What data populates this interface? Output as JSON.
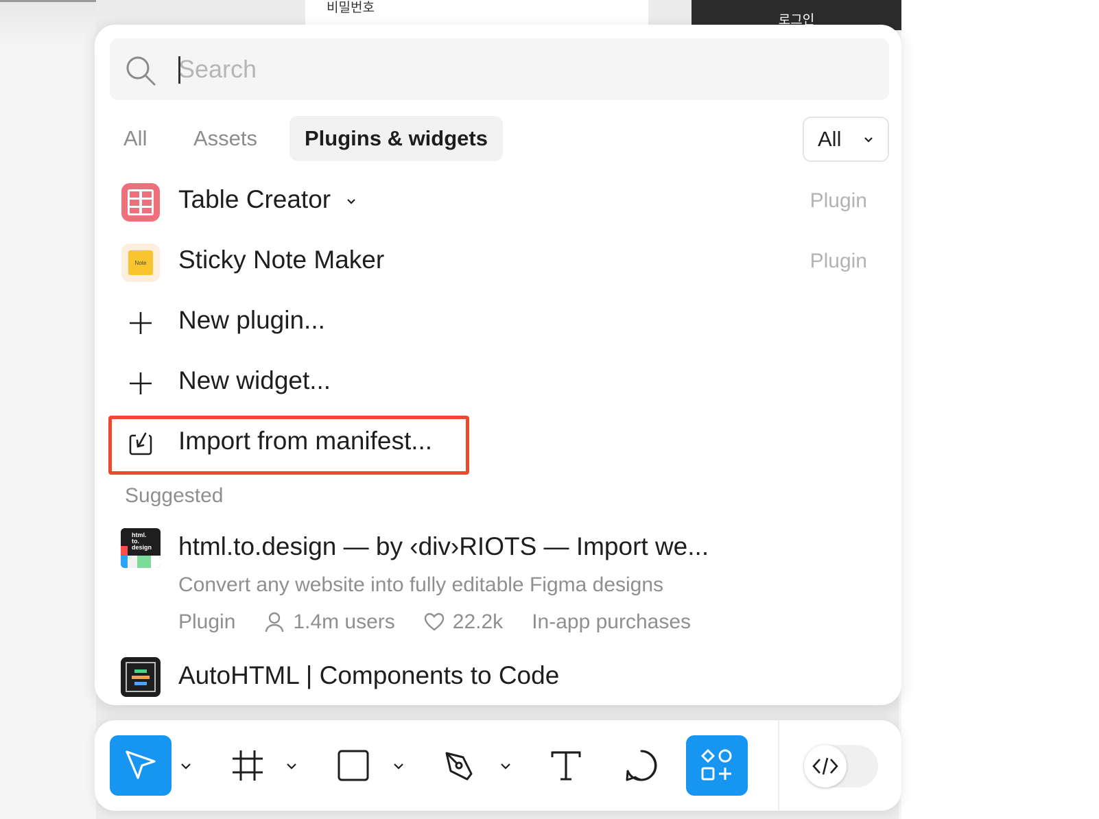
{
  "background": {
    "field_label": "비밀번호",
    "login_button": "로그인"
  },
  "search": {
    "placeholder": "Search",
    "value": ""
  },
  "tabs": [
    {
      "label": "All"
    },
    {
      "label": "Assets"
    },
    {
      "label": "Plugins & widgets"
    }
  ],
  "filter": {
    "selected": "All"
  },
  "items": [
    {
      "label": "Table Creator",
      "kind": "Plugin",
      "icon": "table-icon"
    },
    {
      "label": "Sticky Note Maker",
      "kind": "Plugin",
      "icon": "sticky-note-icon",
      "icon_text": "Note"
    },
    {
      "label": "New plugin...",
      "icon": "plus-icon"
    },
    {
      "label": "New widget...",
      "icon": "plus-icon"
    },
    {
      "label": "Import from manifest...",
      "icon": "import-icon"
    }
  ],
  "suggested": {
    "title": "Suggested",
    "results": [
      {
        "title": "html.to.design — by ‹div›RIOTS — Import we...",
        "description": "Convert any website into fully editable Figma designs",
        "kind": "Plugin",
        "users": "1.4m users",
        "likes": "22.2k",
        "purchase": "In-app purchases",
        "icon_text": [
          "html.",
          "to.",
          "design"
        ]
      },
      {
        "title": "AutoHTML | Components to Code"
      }
    ]
  },
  "colors": {
    "accent": "#1695f1",
    "highlight": "#ec4a2d",
    "table_icon": "#ef6f7d",
    "sticky_icon": "#f9c52e"
  },
  "toolbar": {
    "tools": [
      "move-tool",
      "frame-tool",
      "shape-tool",
      "pen-tool",
      "text-tool",
      "comment-tool",
      "actions-tool"
    ],
    "dev_mode": "dev-mode-toggle"
  }
}
